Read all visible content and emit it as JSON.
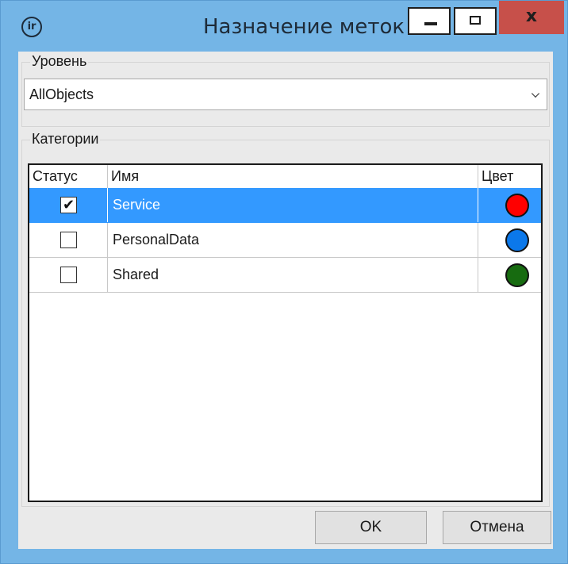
{
  "window": {
    "title": "Назначение меток",
    "close_label": "x"
  },
  "level": {
    "group_label": "Уровень",
    "selected": "AllObjects"
  },
  "categories": {
    "group_label": "Категории",
    "columns": [
      "Статус",
      "Имя",
      "Цвет"
    ],
    "rows": [
      {
        "checked": true,
        "check_mark": "✔",
        "name": "Service",
        "color": "#ff0000",
        "selected": true
      },
      {
        "checked": false,
        "check_mark": "",
        "name": "PersonalData",
        "color": "#0b78ea",
        "selected": false
      },
      {
        "checked": false,
        "check_mark": "",
        "name": "Shared",
        "color": "#176b10",
        "selected": false
      }
    ]
  },
  "buttons": {
    "ok": "OK",
    "cancel": "Отмена"
  }
}
